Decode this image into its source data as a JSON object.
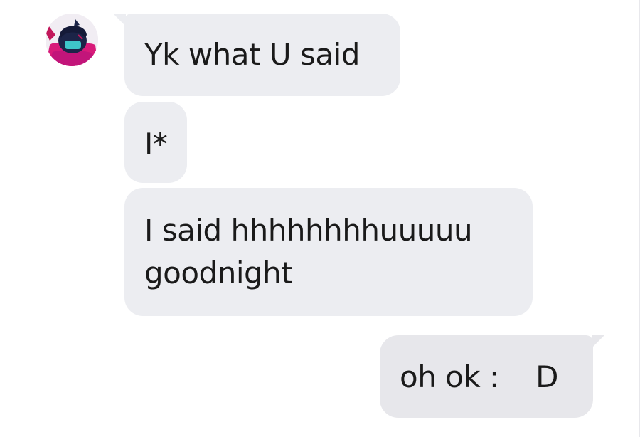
{
  "conversation": {
    "messages": [
      {
        "sender": "contact",
        "text": "Yk what U said"
      },
      {
        "sender": "contact",
        "text": "I*"
      },
      {
        "sender": "contact",
        "lines": [
          "I said hhhhhhhhuuuuu",
          "goodnight"
        ]
      },
      {
        "sender": "me",
        "text": "oh ok :    D"
      }
    ]
  },
  "colors": {
    "incoming_bubble": "#ecedf1",
    "outgoing_bubble": "#e7e7eb",
    "text": "#1a1a1a",
    "background": "#ffffff"
  },
  "icons": {
    "avatar": "contact-avatar-icon"
  }
}
